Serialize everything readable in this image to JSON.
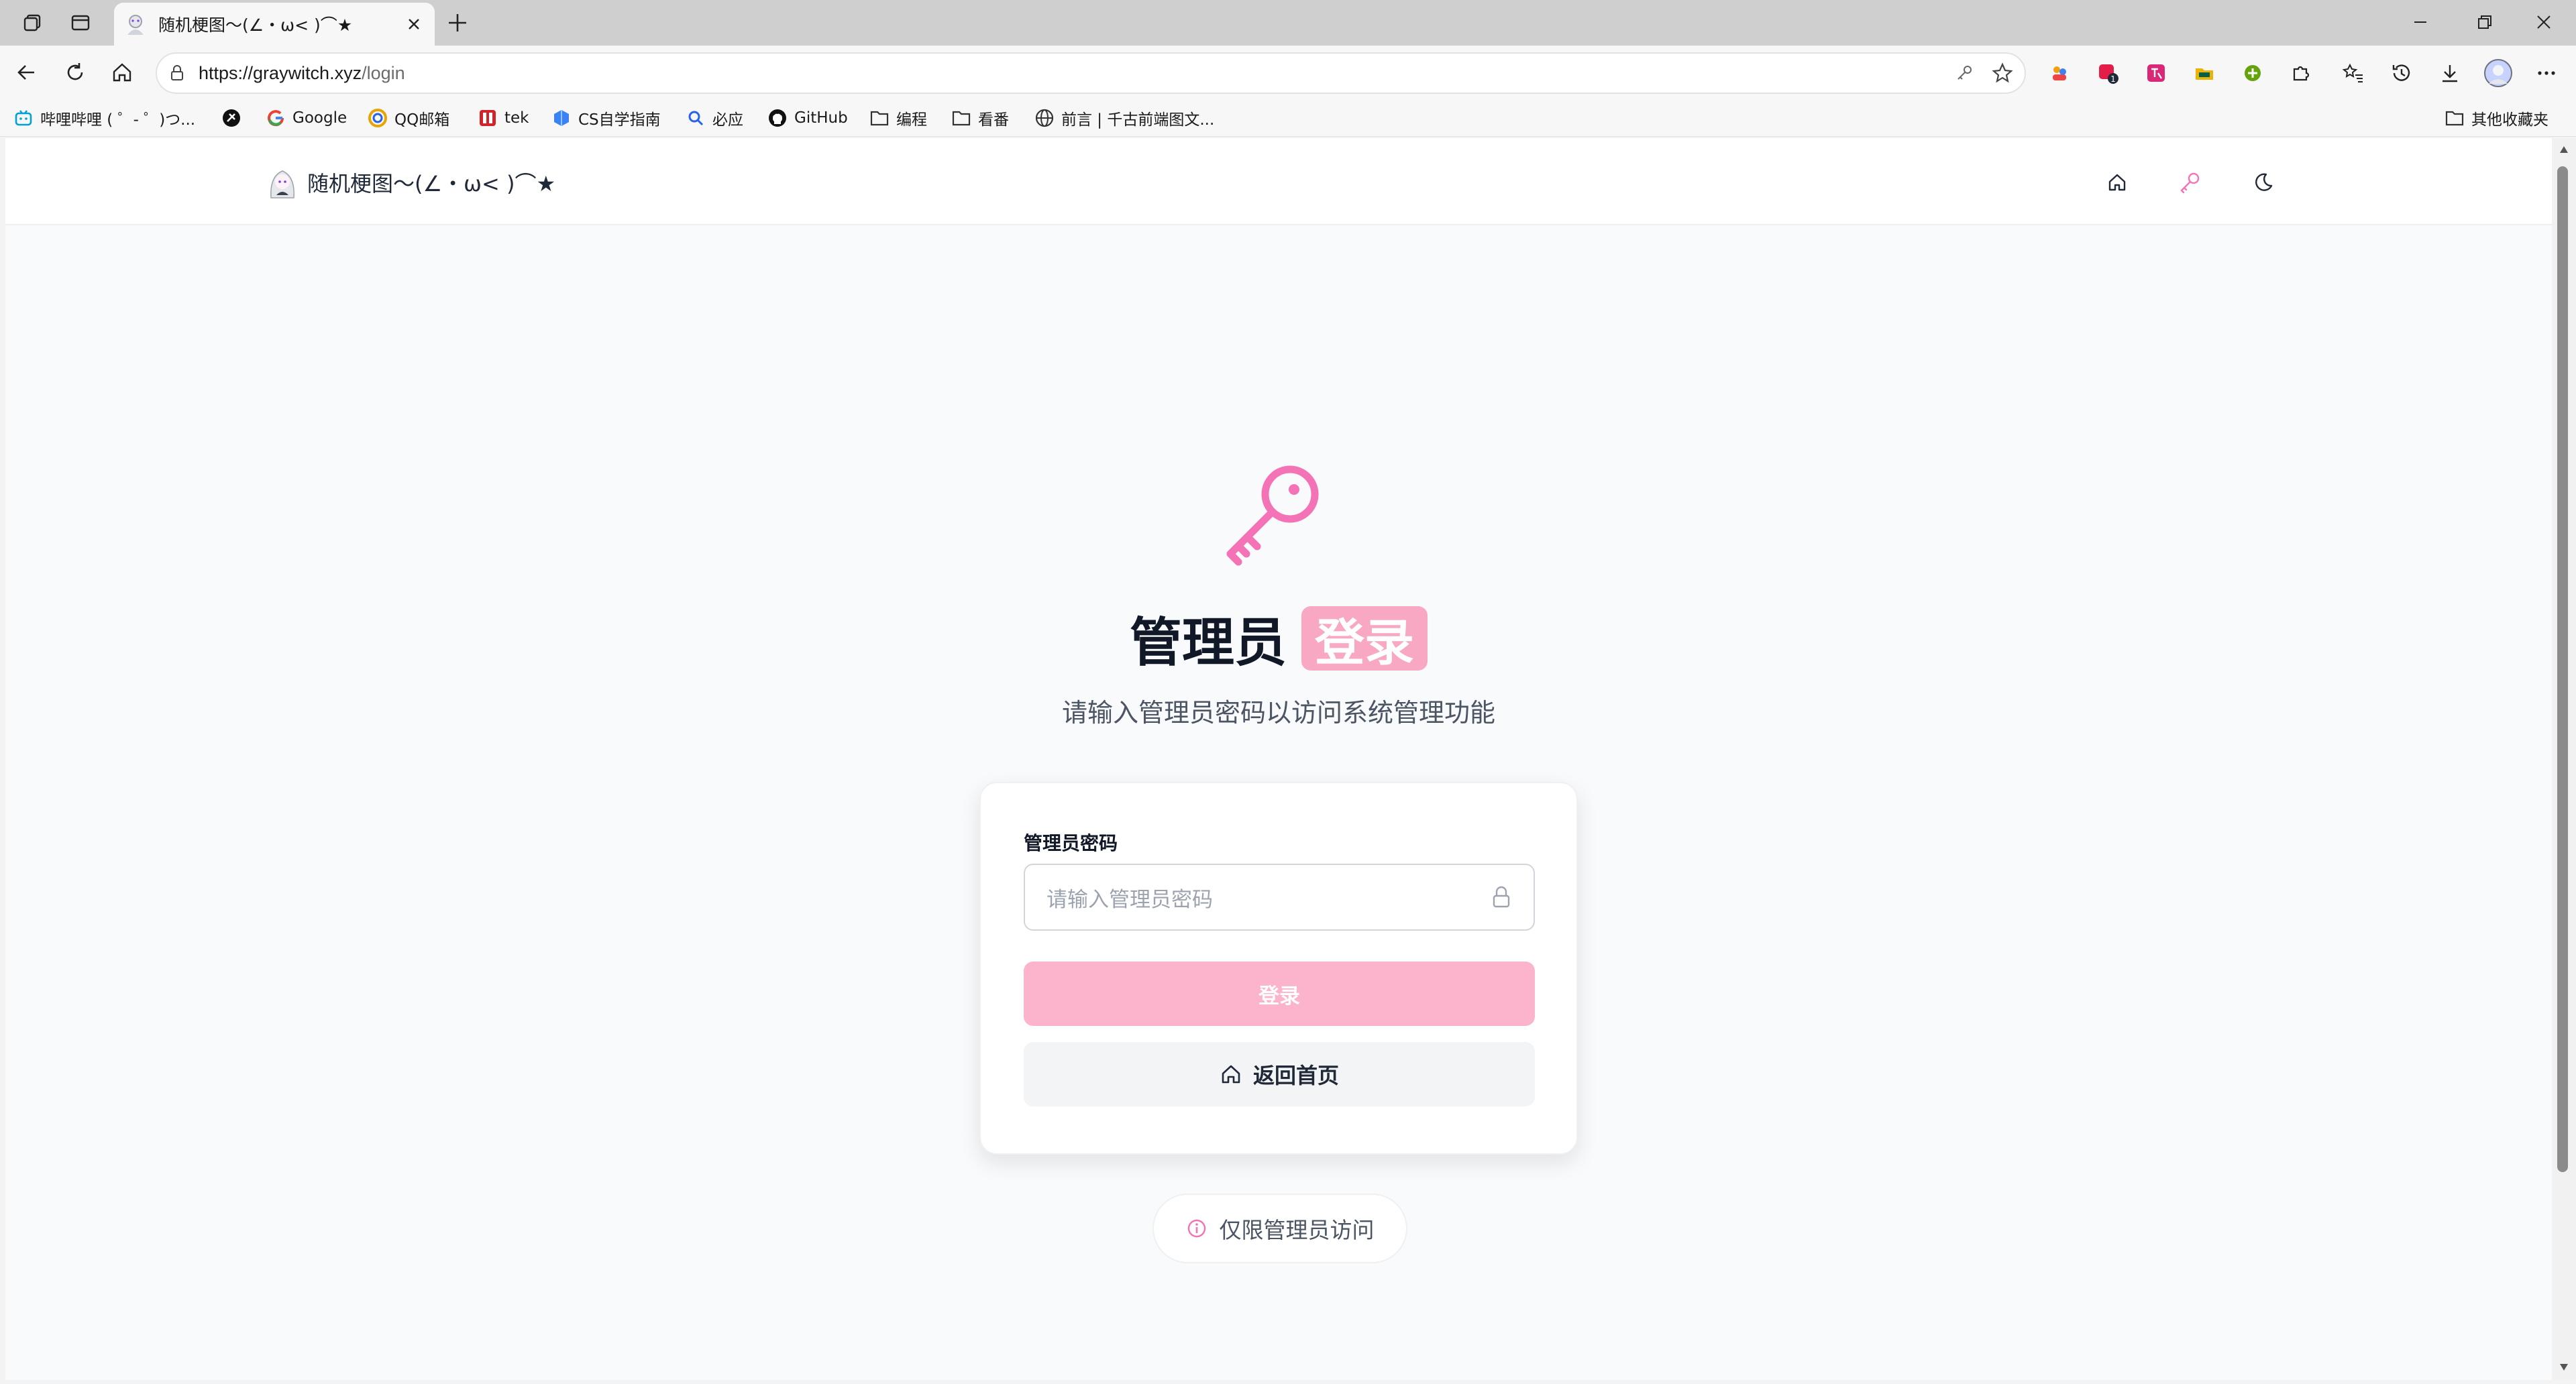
{
  "browser": {
    "tab_title": "随机梗图～(∠・ω< )⌒★",
    "new_tab_symbol": "+",
    "url_host": "https://graywitch.xyz",
    "url_path": "/login",
    "bookmarks": [
      {
        "label": "哔哩哔哩 ( ゜- ゜)つ...",
        "icon": "bilibili-icon",
        "color": "#00a1d6"
      },
      {
        "label": "",
        "icon": "black-circle-icon",
        "color": "#111111"
      },
      {
        "label": "Google",
        "icon": "google-icon",
        "color": "#4285f4"
      },
      {
        "label": "QQ邮箱",
        "icon": "qq-mail-icon",
        "color": "#e8a400"
      },
      {
        "label": "tek",
        "icon": "tek-icon",
        "color": "#d4222a"
      },
      {
        "label": "CS自学指南",
        "icon": "cs-guide-icon",
        "color": "#3b82f6"
      },
      {
        "label": "必应",
        "icon": "bing-search-icon",
        "color": "#2563eb"
      },
      {
        "label": "GitHub",
        "icon": "github-icon",
        "color": "#111111"
      },
      {
        "label": "编程",
        "icon": "folder-icon",
        "color": "#333333"
      },
      {
        "label": "看番",
        "icon": "folder-icon",
        "color": "#333333"
      },
      {
        "label": "前言 | 千古前端图文...",
        "icon": "globe-icon",
        "color": "#333333"
      }
    ],
    "other_bookmarks": "其他收藏夹"
  },
  "site": {
    "brand": "随机梗图～(∠・ω< )⌒★",
    "accent": "#f472b6"
  },
  "login": {
    "title": "管理员",
    "title_badge": "登录",
    "subtitle": "请输入管理员密码以访问系统管理功能",
    "password_label": "管理员密码",
    "password_placeholder": "请输入管理员密码",
    "login_button": "登录",
    "home_button": "返回首页",
    "notice": "仅限管理员访问"
  }
}
